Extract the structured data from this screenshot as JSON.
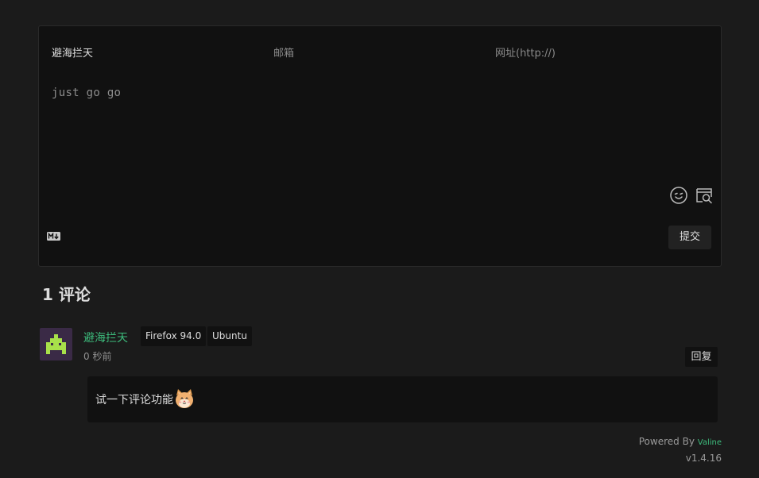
{
  "form": {
    "nick_placeholder": "避海拦天",
    "mail_placeholder": "邮箱",
    "link_placeholder": "网址(http://)",
    "comment_text": "just go go",
    "emoji_icon": "emoji-face-icon",
    "preview_icon": "preview-icon",
    "markdown_icon": "markdown-icon",
    "submit_label": "提交"
  },
  "comments_header": {
    "count": "1",
    "label": "评论"
  },
  "comment": {
    "author": "避海拦天",
    "browser": "Firefox 94.0",
    "os": "Ubuntu",
    "time": "0 秒前",
    "reply_label": "回复",
    "text": "试一下评论功能",
    "sticker": "cat-face-icon"
  },
  "footer": {
    "powered_label": "Powered By",
    "brand": "Valine",
    "version": "v1.4.16"
  },
  "colors": {
    "background": "#1b1b1b",
    "panel": "#111111",
    "accent": "#3dbd7d",
    "avatar_bg": "#3a2a46",
    "avatar_fg": "#a8e04a"
  }
}
